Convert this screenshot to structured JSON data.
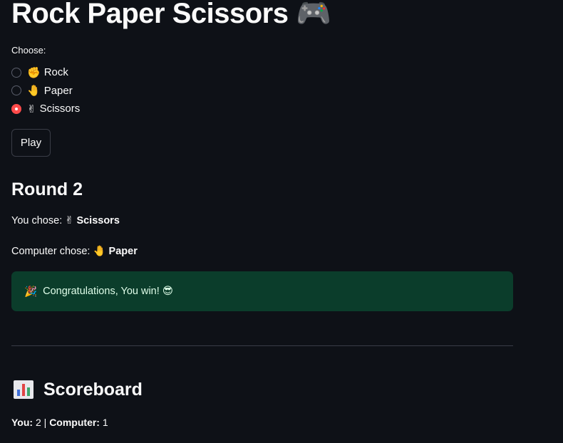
{
  "header": {
    "title": "Rock Paper Scissors",
    "title_icon": "🎮"
  },
  "choice_form": {
    "label": "Choose:",
    "options": [
      {
        "emoji": "✊",
        "label": "Rock",
        "selected": false
      },
      {
        "emoji": "🤚",
        "label": "Paper",
        "selected": false
      },
      {
        "emoji": "✌",
        "label": "Scissors",
        "selected": true
      }
    ],
    "play_label": "Play"
  },
  "round": {
    "heading": "Round 2",
    "you_chose_prefix": "You chose: ",
    "you_chose_emoji": "✌",
    "you_chose_value": "Scissors",
    "computer_chose_prefix": "Computer chose: ",
    "computer_chose_emoji": "🤚",
    "computer_chose_value": "Paper"
  },
  "result": {
    "icon": "🎉",
    "message": "Congratulations, You win!",
    "trailing_emoji": "😎",
    "status": "success"
  },
  "scoreboard": {
    "icon": "bar-chart-icon",
    "heading": "Scoreboard",
    "you_label": "You:",
    "you_score": "2",
    "separator": " | ",
    "computer_label": "Computer:",
    "computer_score": "1"
  },
  "colors": {
    "background": "#0e1117",
    "accent": "#ff4b4b",
    "success_bg": "#0b3d2b",
    "success_text": "#dffde9"
  }
}
